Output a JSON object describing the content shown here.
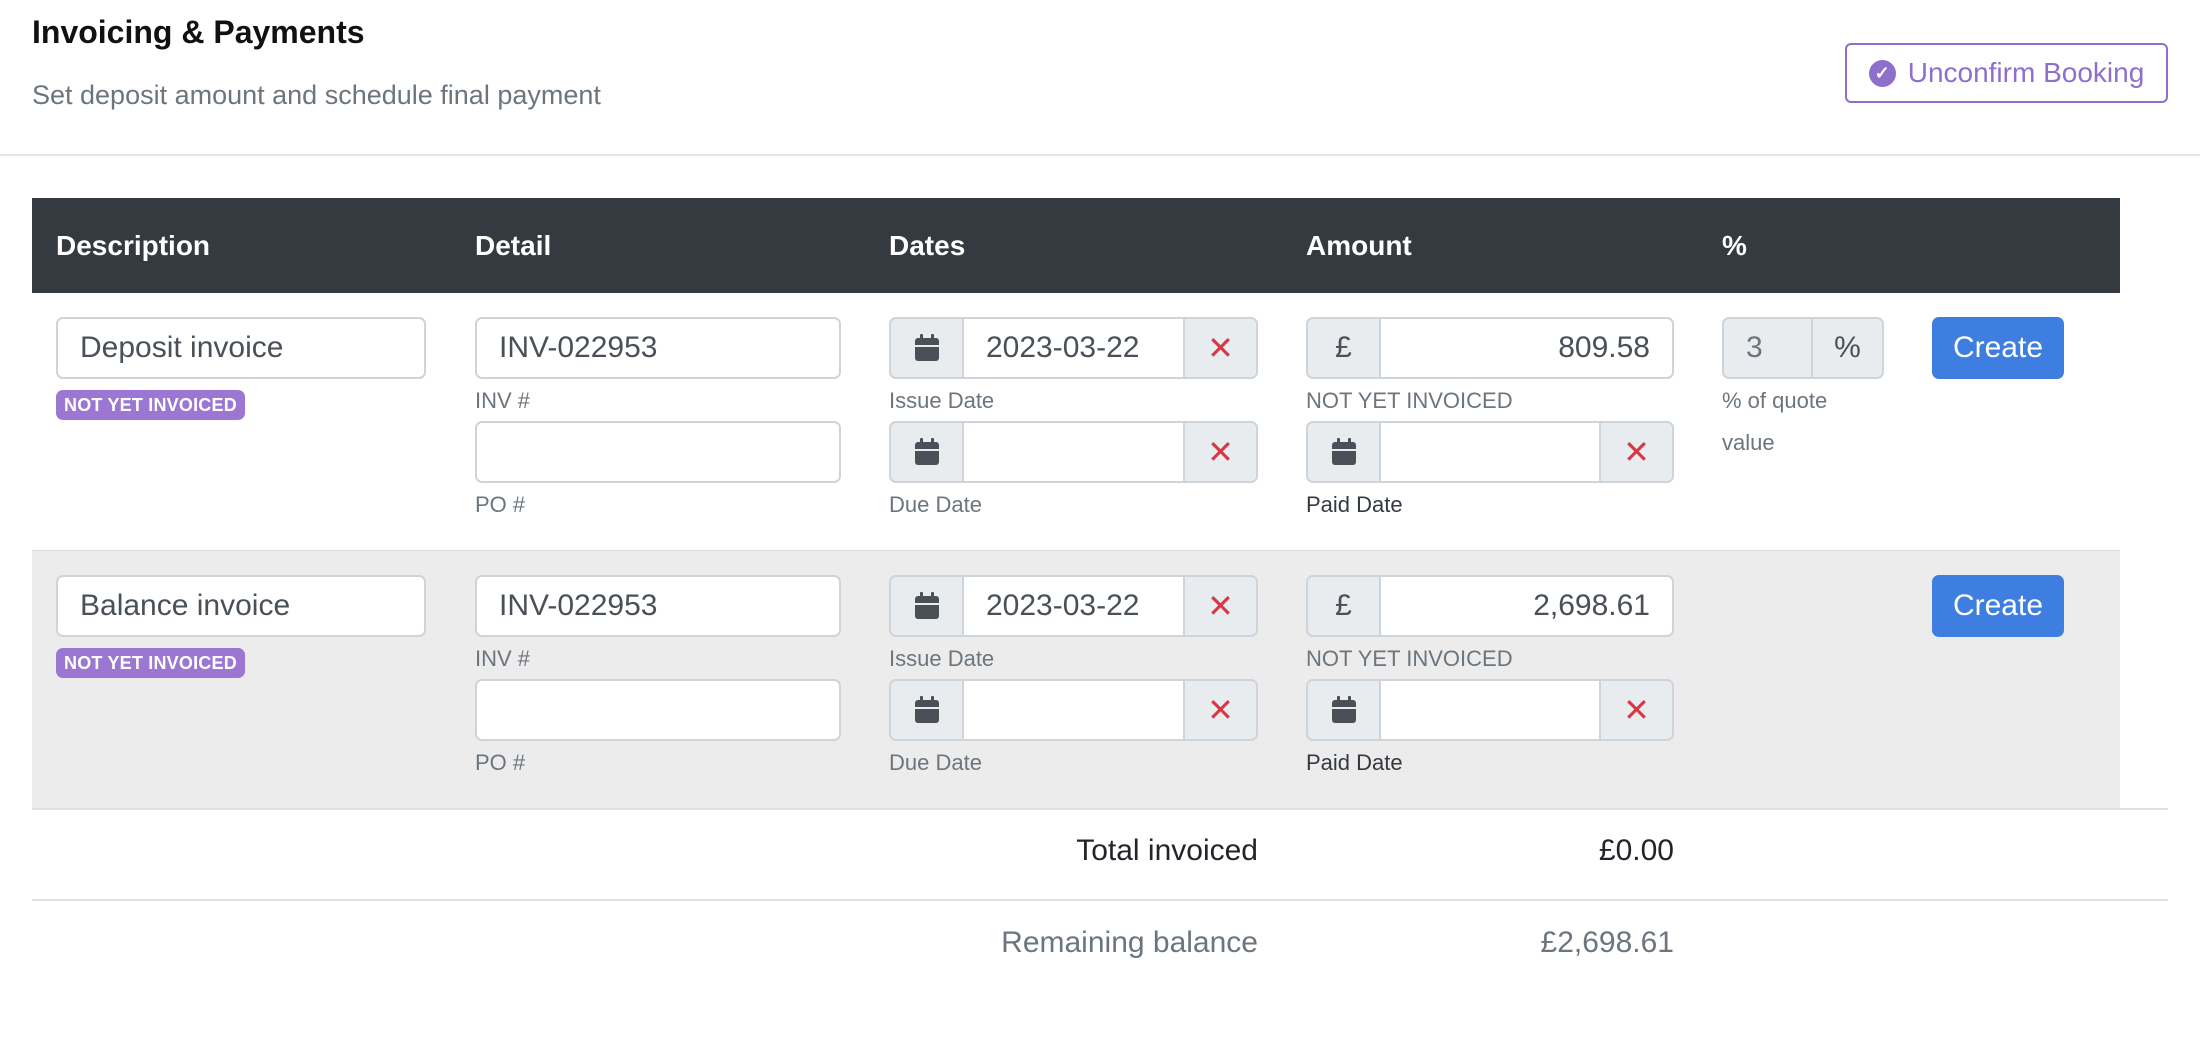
{
  "header": {
    "title": "Invoicing & Payments",
    "subtitle": "Set deposit amount and schedule final payment",
    "unconfirm_label": "Unconfirm Booking"
  },
  "table": {
    "columns": [
      "Description",
      "Detail",
      "Dates",
      "Amount",
      "%"
    ]
  },
  "rows": [
    {
      "description": "Deposit invoice",
      "status_badge": "NOT YET INVOICED",
      "inv_number": "INV-022953",
      "inv_label": "INV #",
      "po_number": "",
      "po_label": "PO #",
      "issue_date": "2023-03-22",
      "issue_label": "Issue Date",
      "due_date": "",
      "due_label": "Due Date",
      "currency": "£",
      "amount": "809.58",
      "amount_status": "NOT YET INVOICED",
      "paid_date": "",
      "paid_label": "Paid Date",
      "percent_value": "3",
      "percent_symbol": "%",
      "percent_hint_1": "% of quote",
      "percent_hint_2": "value",
      "create_label": "Create"
    },
    {
      "description": "Balance invoice",
      "status_badge": "NOT YET INVOICED",
      "inv_number": "INV-022953",
      "inv_label": "INV #",
      "po_number": "",
      "po_label": "PO #",
      "issue_date": "2023-03-22",
      "issue_label": "Issue Date",
      "due_date": "",
      "due_label": "Due Date",
      "currency": "£",
      "amount": "2,698.61",
      "amount_status": "NOT YET INVOICED",
      "paid_date": "",
      "paid_label": "Paid Date",
      "create_label": "Create"
    }
  ],
  "totals": {
    "invoiced_label": "Total invoiced",
    "invoiced_value": "£0.00",
    "remaining_label": "Remaining balance",
    "remaining_value": "£2,698.61"
  },
  "icons": {
    "calendar": "calendar-icon",
    "clear": "x-icon",
    "check": "check-circle-icon"
  },
  "colors": {
    "accent_purple": "#8e6fcd",
    "badge_purple": "#9b77d3",
    "primary_blue": "#3d7ee0",
    "header_dark": "#343a40",
    "danger_red": "#dc3545"
  }
}
